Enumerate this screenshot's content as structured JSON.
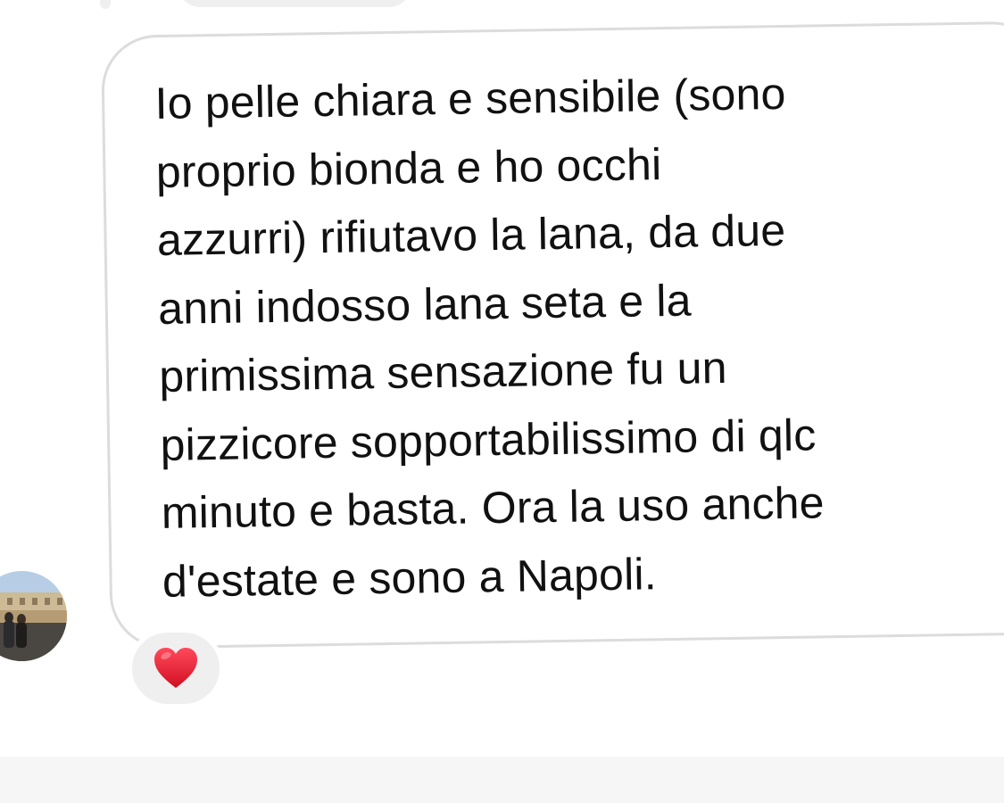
{
  "message": {
    "lines": [
      "Io pelle chiara e sensibile (sono",
      "proprio bionda e ho occhi",
      "azzurri) rifiutavo la lana, da due",
      "anni indosso lana seta e la",
      "primissima sensazione fu un",
      "pizzicore sopportabilissimo di qlc",
      "minuto e basta. Ora la uso anche",
      "d'estate e sono a Napoli."
    ]
  },
  "sender": {
    "avatar_icon": "profile-photo"
  },
  "reaction": {
    "icon": "red-heart-icon",
    "color": "#e0182d"
  },
  "colors": {
    "bubble_border": "#dcdcdc",
    "reaction_background": "#efefef",
    "text": "#111111"
  }
}
